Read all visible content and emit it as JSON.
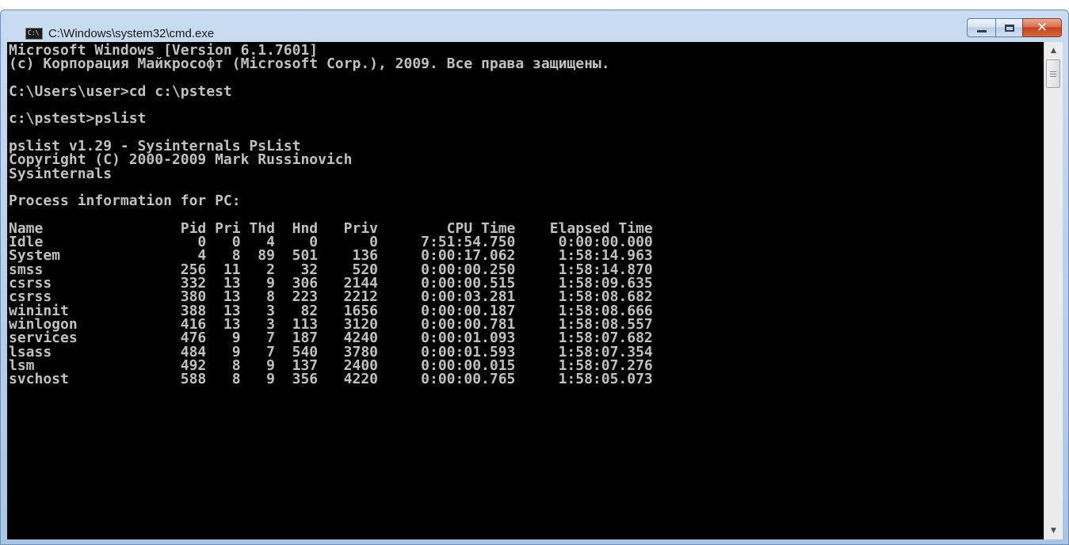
{
  "window": {
    "title": "C:\\Windows\\system32\\cmd.exe",
    "icon": "cmd-icon",
    "icon_text": "C:\\"
  },
  "console": {
    "lines": [
      "Microsoft Windows [Version 6.1.7601]",
      "(c) Корпорация Майкрософт (Microsoft Corp.), 2009. Все права защищены.",
      "",
      "C:\\Users\\user>cd c:\\pstest",
      "",
      "c:\\pstest>pslist",
      "",
      "pslist v1.29 - Sysinternals PsList",
      "Copyright (C) 2000-2009 Mark Russinovich",
      "Sysinternals",
      "",
      "Process information for PC:",
      "",
      "Name                Pid Pri Thd  Hnd   Priv        CPU Time    Elapsed Time",
      "Idle                  0   0   4    0      0     7:51:54.750     0:00:00.000",
      "System                4   8  89  501    136     0:00:17.062     1:58:14.963",
      "smss                256  11   2   32    520     0:00:00.250     1:58:14.870",
      "csrss               332  13   9  306   2144     0:00:00.515     1:58:09.635",
      "csrss               380  13   8  223   2212     0:00:03.281     1:58:08.682",
      "wininit             388  13   3   82   1656     0:00:00.187     1:58:08.666",
      "winlogon            416  13   3  113   3120     0:00:00.781     1:58:08.557",
      "services            476   9   7  187   4240     0:00:01.093     1:58:07.682",
      "lsass               484   9   7  540   3780     0:00:01.593     1:58:07.354",
      "lsm                 492   8   9  137   2400     0:00:00.015     1:58:07.276",
      "svchost             588   8   9  356   4220     0:00:00.765     1:58:05.073"
    ]
  },
  "caption_buttons": {
    "minimize": "minimize-icon",
    "maximize": "maximize-icon",
    "close_glyph": "✕"
  },
  "scrollbar": {
    "up_glyph": "▲",
    "down_glyph": "▼"
  }
}
